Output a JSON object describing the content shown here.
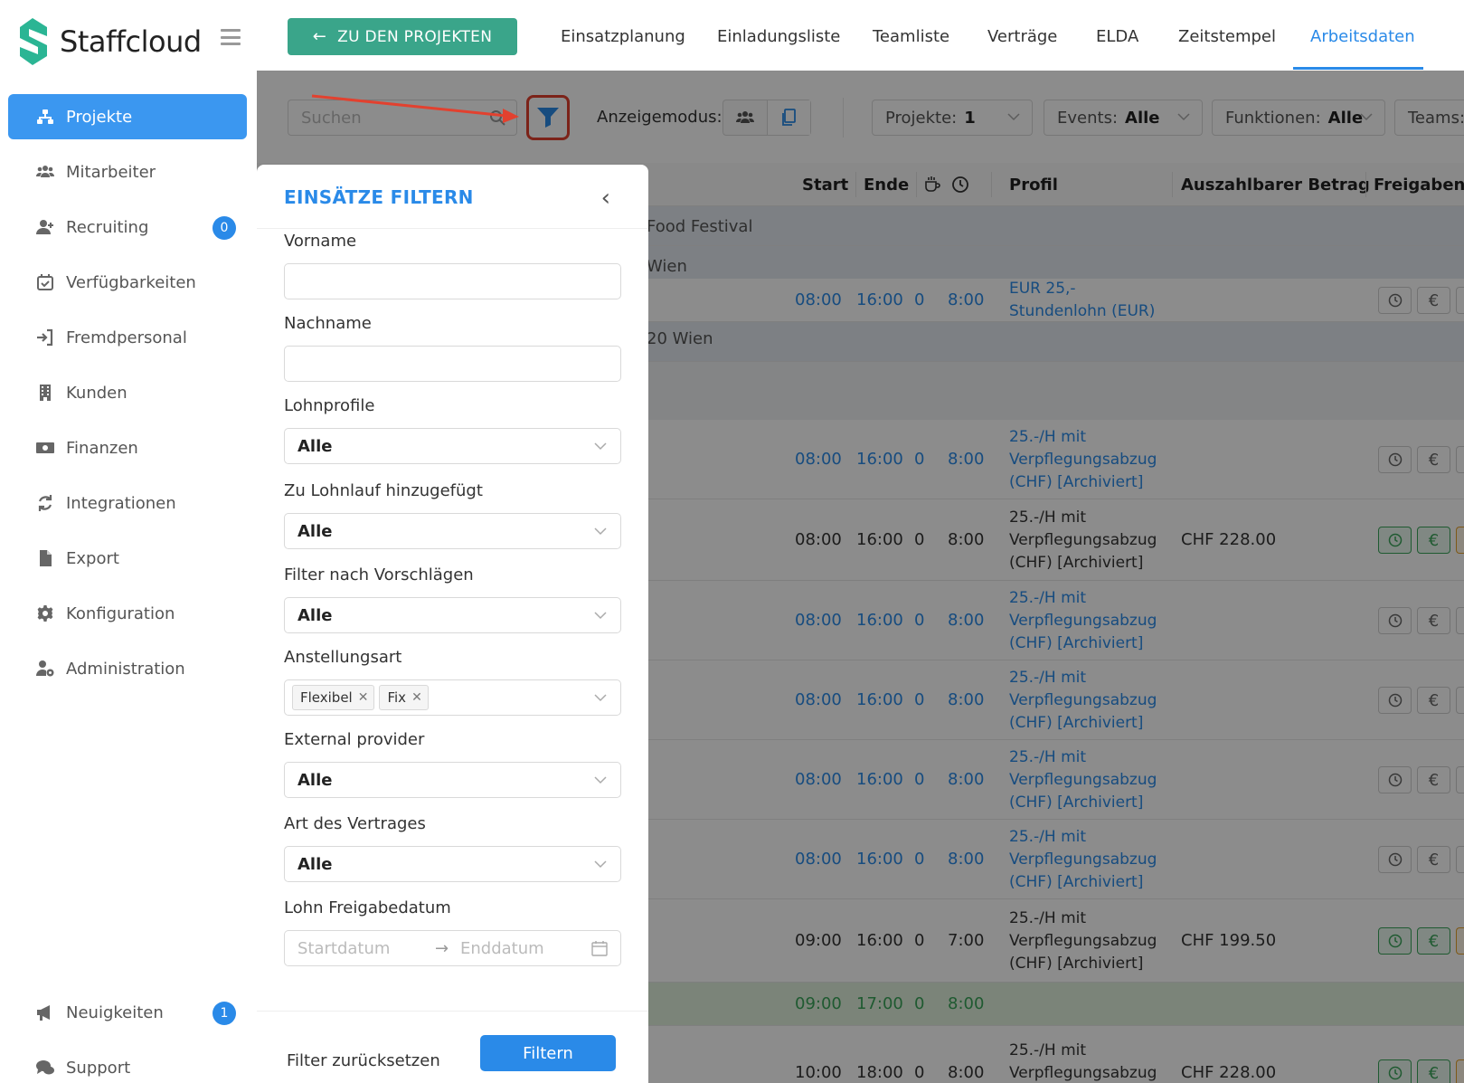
{
  "brand": {
    "name": "Staffcloud",
    "color": "#2bb594"
  },
  "sidebar": {
    "items": [
      {
        "label": "Projekte",
        "icon": "sitemap-icon",
        "active": true
      },
      {
        "label": "Mitarbeiter",
        "icon": "users-icon"
      },
      {
        "label": "Recruiting",
        "icon": "user-plus-icon",
        "badge": "0"
      },
      {
        "label": "Verfügbarkeiten",
        "icon": "calendar-check-icon"
      },
      {
        "label": "Fremdpersonal",
        "icon": "sign-in-icon"
      },
      {
        "label": "Kunden",
        "icon": "building-icon"
      },
      {
        "label": "Finanzen",
        "icon": "money-icon"
      },
      {
        "label": "Integrationen",
        "icon": "sync-icon"
      },
      {
        "label": "Export",
        "icon": "file-icon"
      },
      {
        "label": "Konfiguration",
        "icon": "gear-icon"
      },
      {
        "label": "Administration",
        "icon": "user-cog-icon"
      }
    ],
    "bottom": [
      {
        "label": "Neuigkeiten",
        "icon": "megaphone-icon",
        "badge": "1"
      },
      {
        "label": "Support",
        "icon": "comments-icon"
      }
    ]
  },
  "topbar": {
    "back_label": "ZU DEN PROJEKTEN",
    "tabs": [
      "Einsatzplanung",
      "Einladungsliste",
      "Teamliste",
      "Verträge",
      "ELDA",
      "Zeitstempel",
      "Arbeitsdaten"
    ],
    "active_tab": "Arbeitsdaten"
  },
  "toolbar": {
    "search_placeholder": "Suchen",
    "mode_label": "Anzeigemodus:",
    "selects": [
      {
        "label": "Projekte:",
        "value": "1"
      },
      {
        "label": "Events:",
        "value": "Alle"
      },
      {
        "label": "Funktionen:",
        "value": "Alle"
      },
      {
        "label": "Teams:",
        "value": ""
      }
    ]
  },
  "table": {
    "headers": [
      "Start",
      "Ende",
      "Profil",
      "Auszahlbarer Betrag",
      "Freigaben"
    ],
    "groups": [
      "Food Festival",
      "Wien",
      "20 Wien"
    ],
    "rows": [
      {
        "start": "08:00",
        "end": "16:00",
        "break": "0",
        "hours": "8:00",
        "profile": [
          "EUR 25,-",
          "Stundenlohn (EUR)"
        ],
        "amount": "",
        "color": "blue"
      },
      {
        "start": "08:00",
        "end": "16:00",
        "break": "0",
        "hours": "8:00",
        "profile": [
          "25.-/H mit",
          "Verpflegungsabzug",
          "(CHF) [Archiviert]"
        ],
        "amount": "",
        "color": "blue"
      },
      {
        "start": "08:00",
        "end": "16:00",
        "break": "0",
        "hours": "8:00",
        "profile": [
          "25.-/H mit",
          "Verpflegungsabzug",
          "(CHF) [Archiviert]"
        ],
        "amount": "CHF 228.00",
        "color": "dark"
      },
      {
        "start": "08:00",
        "end": "16:00",
        "break": "0",
        "hours": "8:00",
        "profile": [
          "25.-/H mit",
          "Verpflegungsabzug",
          "(CHF) [Archiviert]"
        ],
        "amount": "",
        "color": "blue"
      },
      {
        "start": "08:00",
        "end": "16:00",
        "break": "0",
        "hours": "8:00",
        "profile": [
          "25.-/H mit",
          "Verpflegungsabzug",
          "(CHF) [Archiviert]"
        ],
        "amount": "",
        "color": "blue"
      },
      {
        "start": "08:00",
        "end": "16:00",
        "break": "0",
        "hours": "8:00",
        "profile": [
          "25.-/H mit",
          "Verpflegungsabzug",
          "(CHF) [Archiviert]"
        ],
        "amount": "",
        "color": "blue"
      },
      {
        "start": "08:00",
        "end": "16:00",
        "break": "0",
        "hours": "8:00",
        "profile": [
          "25.-/H mit",
          "Verpflegungsabzug",
          "(CHF) [Archiviert]"
        ],
        "amount": "",
        "color": "blue"
      },
      {
        "start": "09:00",
        "end": "16:00",
        "break": "0",
        "hours": "7:00",
        "profile": [
          "25.-/H mit",
          "Verpflegungsabzug",
          "(CHF) [Archiviert]"
        ],
        "amount": "CHF 199.50",
        "color": "dark"
      },
      {
        "start": "09:00",
        "end": "17:00",
        "break": "0",
        "hours": "8:00",
        "profile": [],
        "amount": "",
        "color": "green"
      },
      {
        "start": "10:00",
        "end": "18:00",
        "break": "0",
        "hours": "8:00",
        "profile": [
          "25.-/H mit",
          "Verpflegungsabzug",
          "(CHF) [Archiviert]"
        ],
        "amount": "CHF 228.00",
        "color": "dark"
      }
    ]
  },
  "drawer": {
    "title": "EINSÄTZE FILTERN",
    "fields": {
      "vorname": {
        "label": "Vorname",
        "value": ""
      },
      "nachname": {
        "label": "Nachname",
        "value": ""
      },
      "lohnprofile": {
        "label": "Lohnprofile",
        "value": "Alle"
      },
      "lohnlauf": {
        "label": "Zu Lohnlauf hinzugefügt",
        "value": "Alle"
      },
      "vorschlaege": {
        "label": "Filter nach Vorschlägen",
        "value": "Alle"
      },
      "anstellungsart": {
        "label": "Anstellungsart",
        "tags": [
          "Flexibel",
          "Fix"
        ]
      },
      "external": {
        "label": "External provider",
        "value": "Alle"
      },
      "vertrag": {
        "label": "Art des Vertrages",
        "value": "Alle"
      },
      "freigabe": {
        "label": "Lohn Freigabedatum",
        "start_placeholder": "Startdatum",
        "end_placeholder": "Enddatum"
      }
    },
    "reset_label": "Filter zurücksetzen",
    "apply_label": "Filtern"
  }
}
